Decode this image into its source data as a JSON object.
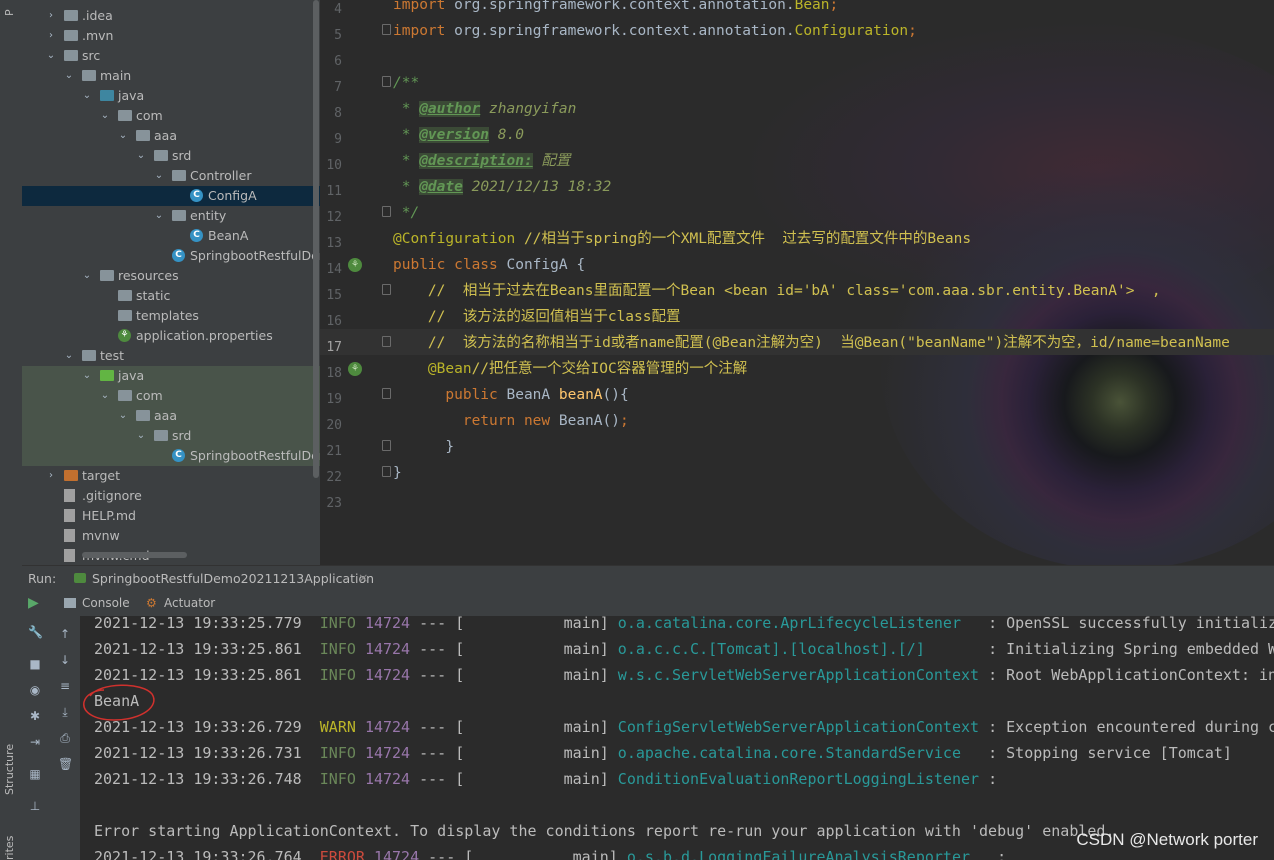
{
  "left_strip": {
    "project_tab": "P",
    "structure_tab": "Structure",
    "favorites_tab": "rites"
  },
  "project_tree": {
    "rows": [
      {
        "depth": 2,
        "arrow": "▸",
        "icon": "folder",
        "label": ".idea"
      },
      {
        "depth": 2,
        "arrow": "▸",
        "icon": "folder",
        "label": ".mvn"
      },
      {
        "depth": 2,
        "arrow": "▾",
        "icon": "folder",
        "label": "src"
      },
      {
        "depth": 3,
        "arrow": "▾",
        "icon": "folder",
        "label": "main"
      },
      {
        "depth": 4,
        "arrow": "▾",
        "icon": "java",
        "label": "java"
      },
      {
        "depth": 5,
        "arrow": "▾",
        "icon": "pkg",
        "label": "com"
      },
      {
        "depth": 6,
        "arrow": "▾",
        "icon": "pkg",
        "label": "aaa"
      },
      {
        "depth": 7,
        "arrow": "▾",
        "icon": "pkg",
        "label": "srd"
      },
      {
        "depth": 8,
        "arrow": "▾",
        "icon": "pkg",
        "label": "Controller"
      },
      {
        "depth": 9,
        "arrow": "",
        "icon": "class",
        "label": "ConfigA",
        "selected": true
      },
      {
        "depth": 8,
        "arrow": "▾",
        "icon": "pkg",
        "label": "entity"
      },
      {
        "depth": 9,
        "arrow": "",
        "icon": "class",
        "label": "BeanA"
      },
      {
        "depth": 8,
        "arrow": "",
        "icon": "class",
        "label": "SpringbootRestfulDem"
      },
      {
        "depth": 4,
        "arrow": "▾",
        "icon": "res",
        "label": "resources"
      },
      {
        "depth": 5,
        "arrow": "",
        "icon": "folder",
        "label": "static"
      },
      {
        "depth": 5,
        "arrow": "",
        "icon": "folder",
        "label": "templates"
      },
      {
        "depth": 5,
        "arrow": "",
        "icon": "props",
        "label": "application.properties"
      },
      {
        "depth": 3,
        "arrow": "▾",
        "icon": "folder",
        "label": "test"
      },
      {
        "depth": 4,
        "arrow": "▾",
        "icon": "testjava",
        "label": "java",
        "testbg": true
      },
      {
        "depth": 5,
        "arrow": "▾",
        "icon": "pkg",
        "label": "com",
        "testbg": true
      },
      {
        "depth": 6,
        "arrow": "▾",
        "icon": "pkg",
        "label": "aaa",
        "testbg": true
      },
      {
        "depth": 7,
        "arrow": "▾",
        "icon": "pkg",
        "label": "srd",
        "testbg": true
      },
      {
        "depth": 8,
        "arrow": "",
        "icon": "class",
        "label": "SpringbootRestfulDem",
        "testbg": true
      },
      {
        "depth": 2,
        "arrow": "▸",
        "icon": "target",
        "label": "target"
      },
      {
        "depth": 2,
        "arrow": "",
        "icon": "file",
        "label": ".gitignore"
      },
      {
        "depth": 2,
        "arrow": "",
        "icon": "file",
        "label": "HELP.md"
      },
      {
        "depth": 2,
        "arrow": "",
        "icon": "file",
        "label": "mvnw"
      },
      {
        "depth": 2,
        "arrow": "",
        "icon": "file",
        "label": "mvnw.cmd"
      }
    ]
  },
  "editor": {
    "line_numbers": [
      "4",
      "5",
      "6",
      "7",
      "8",
      "9",
      "10",
      "11",
      "12",
      "13",
      "14",
      "15",
      "16",
      "17",
      "18",
      "19",
      "20",
      "21",
      "22",
      "23"
    ],
    "lines": {
      "l4_kw": "import",
      "l4_rest": " org.springframework.context.annotation.",
      "l4_cls": "Bean",
      "l4_semi": ";",
      "l5_kw": "import",
      "l5_rest": " org.springframework.context.annotation.",
      "l5_cls": "Configuration",
      "l5_semi": ";",
      "l7": "/**",
      "l8_star": " * ",
      "l8_tag": "@author",
      "l8_val": " zhangyifan",
      "l9_star": " * ",
      "l9_tag": "@version",
      "l9_val": " 8.0",
      "l10_star": " * ",
      "l10_tag": "@description:",
      "l10_val": " 配置",
      "l11_star": " * ",
      "l11_tag": "@date",
      "l11_val": " 2021/12/13 18:32",
      "l12": " */",
      "l13_ann": "@Configuration",
      "l13_cmt": " //相当于spring的一个XML配置文件  过去写的配置文件中的Beans",
      "l14_kw": "public class",
      "l14_rest": " ConfigA {",
      "l15": "    //  相当于过去在Beans里面配置一个Bean <bean id='bA' class='com.aaa.sbr.entity.BeanA'>  ,",
      "l16": "    //  该方法的返回值相当于class配置",
      "l17": "    //  该方法的名称相当于id或者name配置(@Bean注解为空)  当@Bean(\"beanName\")注解不为空，id/name=beanName",
      "l18_ann": "    @Bean",
      "l18_cmt": "//把任意一个交给IOC容器管理的一个注解",
      "l19_kw": "      public",
      "l19_type": " BeanA ",
      "l19_meth": "beanA",
      "l19_rest": "(){",
      "l20_kw": "        return new",
      "l20_rest": " BeanA()",
      "l20_semi": ";",
      "l21": "      }",
      "l22": "}"
    }
  },
  "run_bar": {
    "label": "Run:",
    "config": "SpringbootRestfulDemo20211213Application",
    "close": "×"
  },
  "run_tabs": {
    "console": "Console",
    "actuator": "Actuator"
  },
  "console": {
    "lines": [
      {
        "ts": "2021-12-13 19:33:25.779",
        "level": "INFO",
        "pid": "14724",
        "sep": " --- [",
        "thread": "           main]",
        "logger": " o.a.catalina.core.AprLifecycleListener  ",
        "msg": " : OpenSSL successfully initializ"
      },
      {
        "ts": "2021-12-13 19:33:25.861",
        "level": "INFO",
        "pid": "14724",
        "sep": " --- [",
        "thread": "           main]",
        "logger": " o.a.c.c.C.[Tomcat].[localhost].[/]      ",
        "msg": " : Initializing Spring embedded W"
      },
      {
        "ts": "2021-12-13 19:33:25.861",
        "level": "INFO",
        "pid": "14724",
        "sep": " --- [",
        "thread": "           main]",
        "logger": " w.s.c.ServletWebServerApplicationContext",
        "msg": " : Root WebApplicationContext: in"
      },
      {
        "plain": "BeanA"
      },
      {
        "ts": "2021-12-13 19:33:26.729",
        "level": "WARN",
        "pid": "14724",
        "sep": " --- [",
        "thread": "           main]",
        "logger": " ConfigServletWebServerApplicationContext",
        "msg": " : Exception encountered during c"
      },
      {
        "ts": "2021-12-13 19:33:26.731",
        "level": "INFO",
        "pid": "14724",
        "sep": " --- [",
        "thread": "           main]",
        "logger": " o.apache.catalina.core.StandardService  ",
        "msg": " : Stopping service [Tomcat]"
      },
      {
        "ts": "2021-12-13 19:33:26.748",
        "level": "INFO",
        "pid": "14724",
        "sep": " --- [",
        "thread": "           main]",
        "logger": " ConditionEvaluationReportLoggingListener",
        "msg": " :"
      },
      {
        "plain": ""
      },
      {
        "plain": "Error starting ApplicationContext. To display the conditions report re-run your application with 'debug' enabled."
      },
      {
        "ts": "2021-12-13 19:33:26.764",
        "level": "ERROR",
        "pid": "14724",
        "sep": " --- [",
        "thread": "           main]",
        "logger": " o.s.b.d.LoggingFailureAnalysisReporter  ",
        "msg": " :"
      }
    ]
  },
  "watermark": "CSDN @Network porter"
}
